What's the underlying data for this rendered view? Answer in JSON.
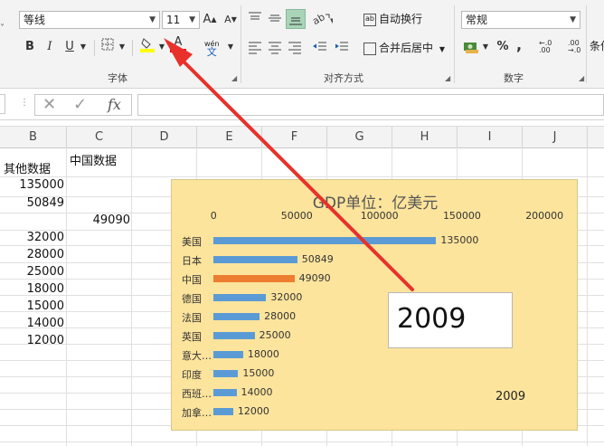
{
  "ribbon": {
    "font_name": "等线",
    "font_size": "11",
    "bold": "B",
    "italic": "I",
    "underline": "U",
    "phonetic_top": "wén",
    "phonetic_bottom": "文",
    "wrap_text": "自动换行",
    "merge_center": "合并后居中",
    "number_format": "常规",
    "percent": "%",
    "comma": ",",
    "inc_decimal": "←.0 .00",
    "dec_decimal": ".00 →.0",
    "font_group": "字体",
    "align_group": "对齐方式",
    "number_group": "数字",
    "cond_format_partial": "条件"
  },
  "formula_bar": {
    "cancel": "✕",
    "confirm": "✓",
    "fx": "fx",
    "content": ""
  },
  "columns": [
    "B",
    "C",
    "D",
    "E",
    "F",
    "G",
    "H",
    "I",
    "J"
  ],
  "cells": {
    "b_header": "其他数据",
    "c_header": "中国数据",
    "b_values": [
      "135000",
      "50849",
      "",
      "32000",
      "28000",
      "25000",
      "18000",
      "15000",
      "14000",
      "12000"
    ],
    "c_value": "49090"
  },
  "colors": {
    "chart_bg": "#fde49c",
    "bar_blue": "#5b9bd5",
    "bar_orange": "#ed7d31",
    "arrow_red": "#e8312a"
  },
  "chart_data": {
    "type": "bar",
    "orientation": "horizontal",
    "title": "GDP单位：亿美元",
    "xlim": [
      0,
      200000
    ],
    "x_ticks": [
      "0",
      "50000",
      "100000",
      "150000",
      "200000"
    ],
    "categories": [
      "美国",
      "日本",
      "中国",
      "德国",
      "法国",
      "英国",
      "意大…",
      "印度",
      "西班…",
      "加拿…"
    ],
    "values": [
      135000,
      50849,
      49090,
      32000,
      28000,
      25000,
      18000,
      15000,
      14000,
      12000
    ],
    "value_labels": [
      "135000",
      "50849",
      "49090",
      "32000",
      "28000",
      "25000",
      "18000",
      "15000",
      "14000",
      "12000"
    ],
    "highlight_index": 2,
    "year_box": "2009",
    "year_label": "2009",
    "grid": false,
    "legend": "none"
  }
}
